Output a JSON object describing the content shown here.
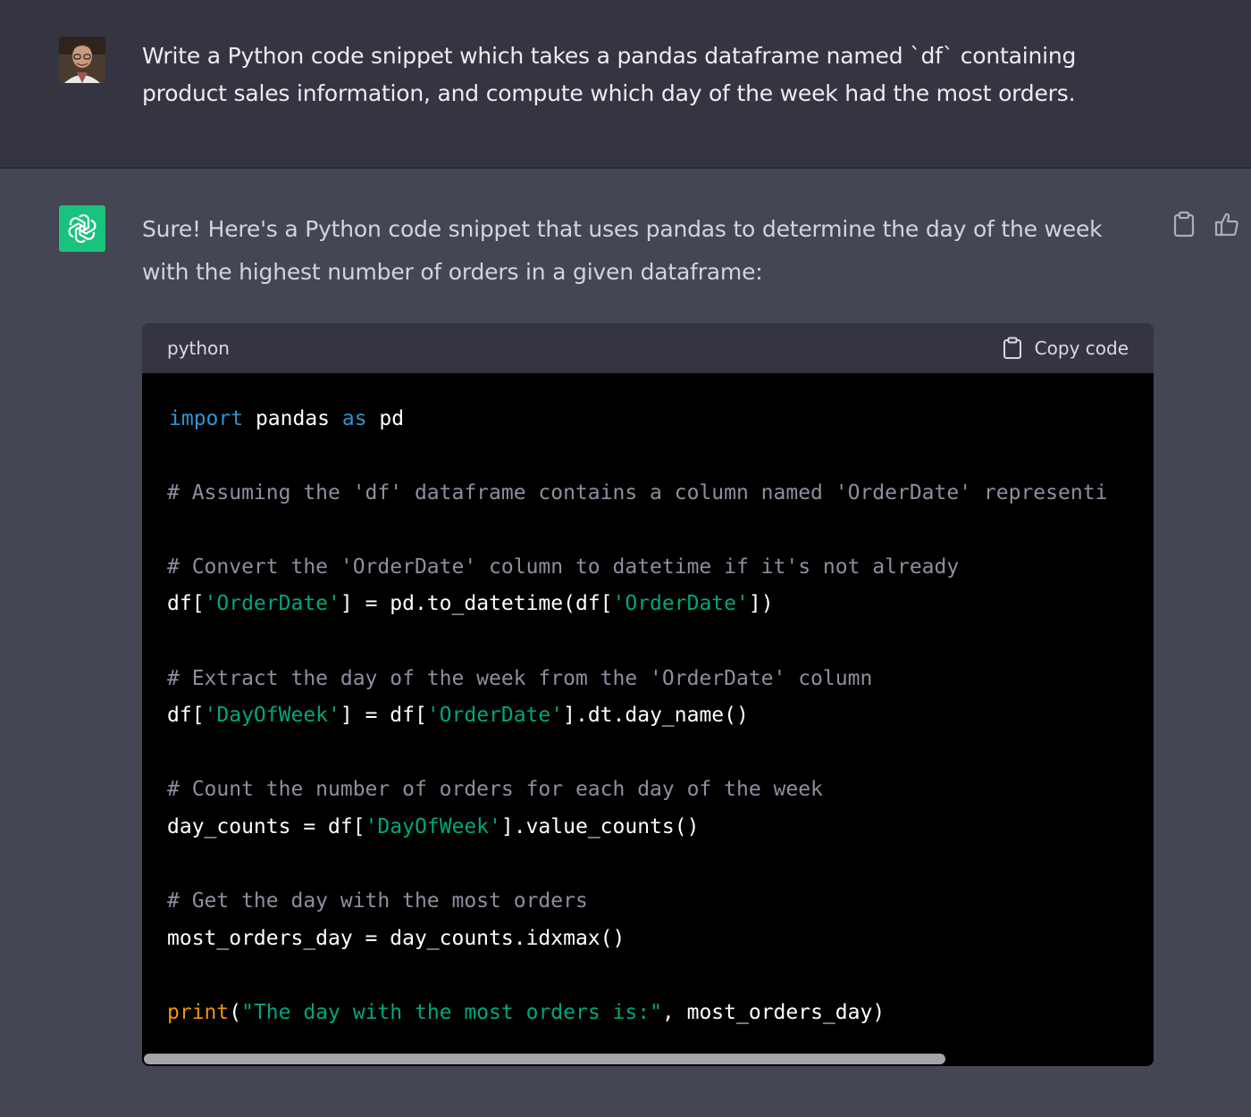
{
  "user_message": {
    "text": "Write a Python code snippet which takes a pandas dataframe named `df` containing product sales information, and compute which day of the week had the most orders."
  },
  "assistant_message": {
    "text": "Sure! Here's a Python code snippet that uses pandas to determine the day of the week with the highest number of orders in a given dataframe:"
  },
  "code_block": {
    "language": "python",
    "copy_label": "Copy code",
    "lines": {
      "l1_kw1": "import",
      "l1_t1": " pandas ",
      "l1_kw2": "as",
      "l1_t2": " pd",
      "l2": "# Assuming the 'df' dataframe contains a column named 'OrderDate' representi",
      "l3": "# Convert the 'OrderDate' column to datetime if it's not already",
      "l4_t1": "df[",
      "l4_s1": "'OrderDate'",
      "l4_t2": "] = pd.to_datetime(df[",
      "l4_s2": "'OrderDate'",
      "l4_t3": "])",
      "l5": "# Extract the day of the week from the 'OrderDate' column",
      "l6_t1": "df[",
      "l6_s1": "'DayOfWeek'",
      "l6_t2": "] = df[",
      "l6_s2": "'OrderDate'",
      "l6_t3": "].dt.day_name()",
      "l7": "# Count the number of orders for each day of the week",
      "l8_t1": "day_counts = df[",
      "l8_s1": "'DayOfWeek'",
      "l8_t2": "].value_counts()",
      "l9": "# Get the day with the most orders",
      "l10": "most_orders_day = day_counts.idxmax()",
      "l11_fn": "print",
      "l11_t1": "(",
      "l11_s1": "\"The day with the most orders is:\"",
      "l11_t2": ", most_orders_day)"
    }
  },
  "colors": {
    "user_bg": "#343541",
    "assistant_bg": "#444654",
    "code_bg": "#000000",
    "keyword": "#2e95d3",
    "string": "#00a67d",
    "comment": "#8e8ea0",
    "builtin": "#e9950c",
    "brand": "#19c37d"
  },
  "icons": [
    "user-avatar",
    "openai-logo-icon",
    "clipboard-icon",
    "thumbs-up-icon"
  ]
}
